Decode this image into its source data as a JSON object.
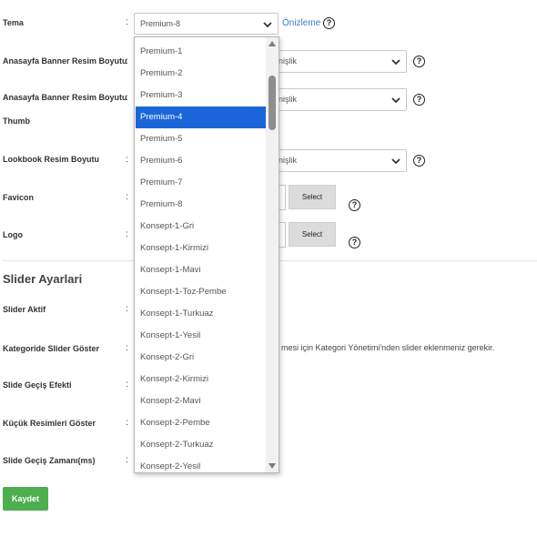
{
  "fields": {
    "tema": {
      "label": "Tema",
      "colon": ":",
      "value": "Premium-8",
      "preview": "Önizleme",
      "help": "?"
    },
    "banner_size": {
      "label": "Anasayfa Banner Resim Boyutu",
      "colon": ":",
      "value": "enişlik",
      "help": "?"
    },
    "banner_thumb": {
      "label": "Anasayfa Banner Resim Boyutu",
      "label2": "Thumb",
      "colon": ":",
      "value": "enişlik",
      "help": "?"
    },
    "lookbook": {
      "label": "Lookbook Resim Boyutu",
      "colon": ":",
      "value": "enişlik",
      "help": "?"
    },
    "favicon": {
      "label": "Favicon",
      "colon": ":",
      "button": "Select",
      "help": "?"
    },
    "logo": {
      "label": "Logo",
      "colon": ":",
      "button": "Select",
      "help": "?"
    }
  },
  "slider_section": {
    "title": "Slider Ayarlari",
    "rows": [
      {
        "label": "Slider Aktif",
        "colon": ":"
      },
      {
        "label": "Kategoride Slider Göster",
        "colon": ":"
      },
      {
        "label": "Slide Geçiş Efekti",
        "colon": ":"
      },
      {
        "label": "Küçük Resimleri Göster",
        "colon": ":"
      },
      {
        "label": "Slide Geçiş Zamanı(ms)",
        "colon": ":"
      }
    ],
    "note": "mesi için Kategori Yönetimi'nden slider eklenmeniz gerekir."
  },
  "save_label": "Kaydet",
  "dropdown": {
    "selected": "Premium-4",
    "options": [
      "Premium-1",
      "Premium-2",
      "Premium-3",
      "Premium-4",
      "Premium-5",
      "Premium-6",
      "Premium-7",
      "Premium-8",
      "Konsept-1-Gri",
      "Konsept-1-Kirmizi",
      "Konsept-1-Mavi",
      "Konsept-1-Toz-Pembe",
      "Konsept-1-Turkuaz",
      "Konsept-1-Yesil",
      "Konsept-2-Gri",
      "Konsept-2-Kirmizi",
      "Konsept-2-Mavi",
      "Konsept-2-Pembe",
      "Konsept-2-Turkuaz",
      "Konsept-2-Yesil"
    ]
  },
  "colors": {
    "accent": "#1a66d9",
    "save": "#4cae4f",
    "link": "#3b7fc4"
  },
  "icons": {
    "chevron": "chevron-down-icon",
    "help": "help-circle-icon"
  }
}
